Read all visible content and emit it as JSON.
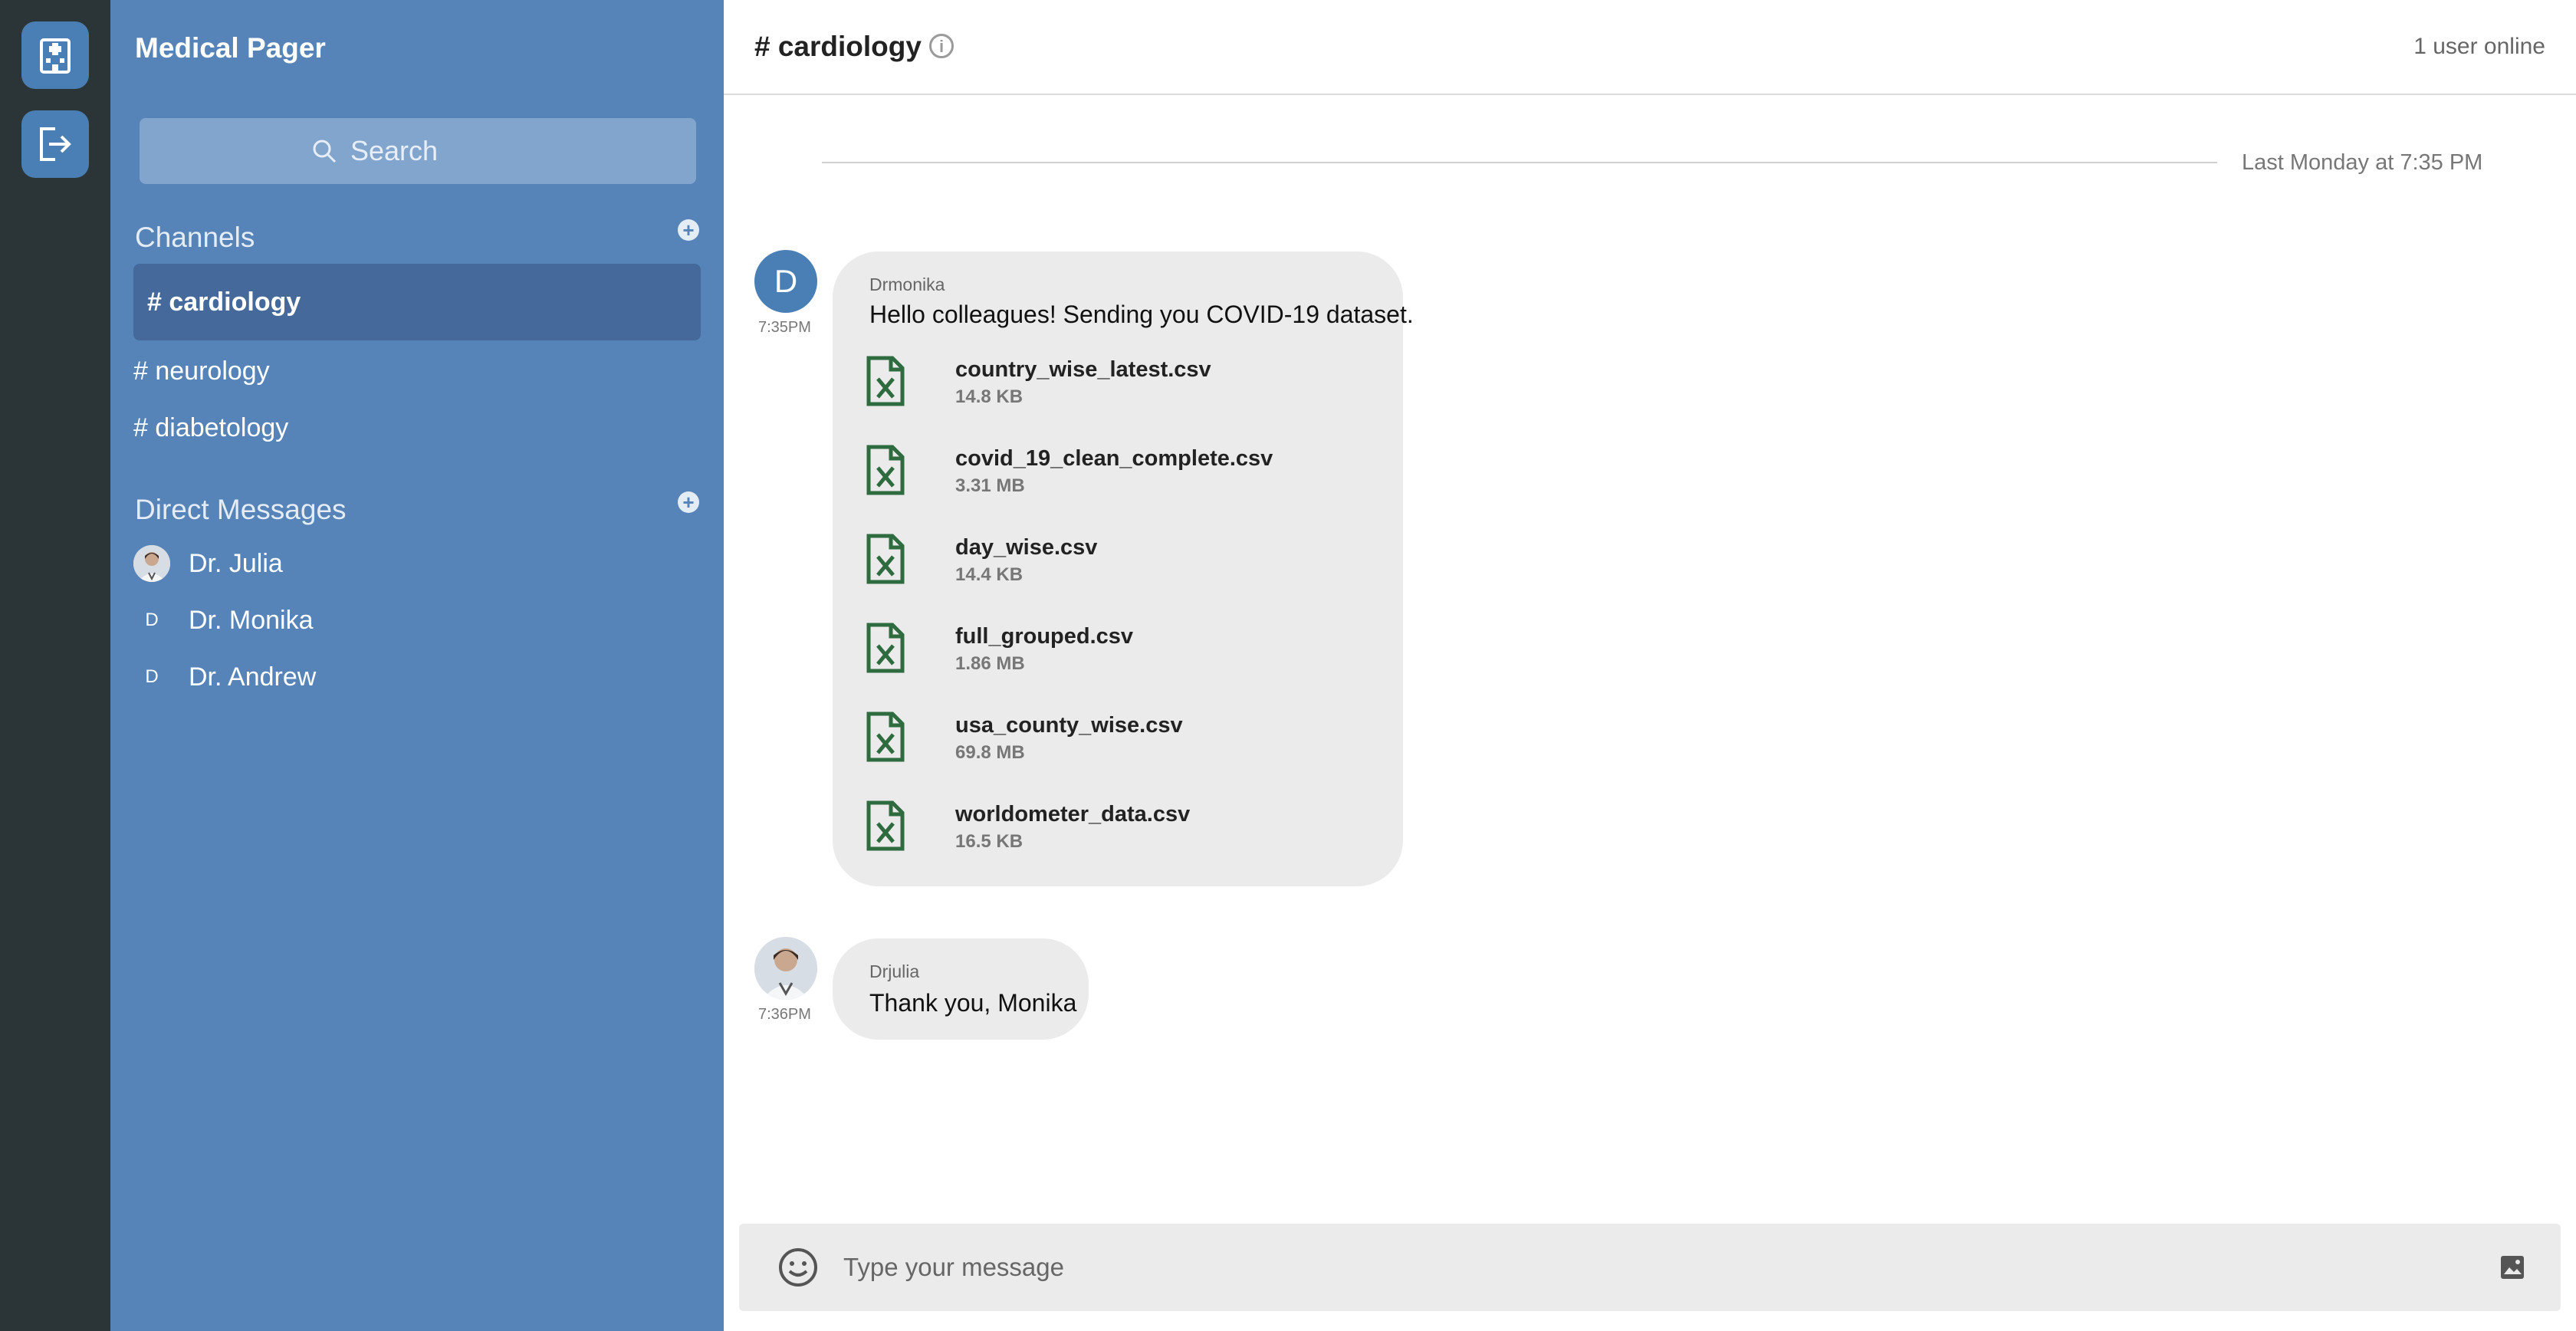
{
  "app": {
    "title": "Medical Pager"
  },
  "rail": {
    "home_icon": "hospital-icon",
    "logout_icon": "logout-icon"
  },
  "search": {
    "placeholder": "Search"
  },
  "sidebar": {
    "channels_title": "Channels",
    "channels": [
      {
        "label": "# cardiology",
        "active": true
      },
      {
        "label": "# neurology",
        "active": false
      },
      {
        "label": "# diabetology",
        "active": false
      }
    ],
    "dm_title": "Direct Messages",
    "dms": [
      {
        "name": "Dr. Julia",
        "avatar": ""
      },
      {
        "name": "Dr. Monika",
        "avatar": "D"
      },
      {
        "name": "Dr. Andrew",
        "avatar": "D"
      }
    ]
  },
  "header": {
    "channel": "# cardiology",
    "online": "1 user online"
  },
  "date_divider": "Last Monday at 7:35 PM",
  "messages": [
    {
      "sender": "Drmonika",
      "avatar": "D",
      "time": "7:35PM",
      "text": "Hello colleagues! Sending you COVID-19 dataset.",
      "attachments": [
        {
          "name": "country_wise_latest.csv",
          "size": "14.8 KB"
        },
        {
          "name": "covid_19_clean_complete.csv",
          "size": "3.31 MB"
        },
        {
          "name": "day_wise.csv",
          "size": "14.4 KB"
        },
        {
          "name": "full_grouped.csv",
          "size": "1.86 MB"
        },
        {
          "name": "usa_county_wise.csv",
          "size": "69.8 MB"
        },
        {
          "name": "worldometer_data.csv",
          "size": "16.5 KB"
        }
      ]
    },
    {
      "sender": "Drjulia",
      "avatar": "",
      "time": "7:36PM",
      "text": "Thank you, Monika"
    }
  ],
  "composer": {
    "placeholder": "Type your message"
  },
  "colors": {
    "sidebar": "#5784b8",
    "rail": "#2b3538",
    "accent": "#4a7fb5",
    "file_icon": "#2e6b3f"
  }
}
